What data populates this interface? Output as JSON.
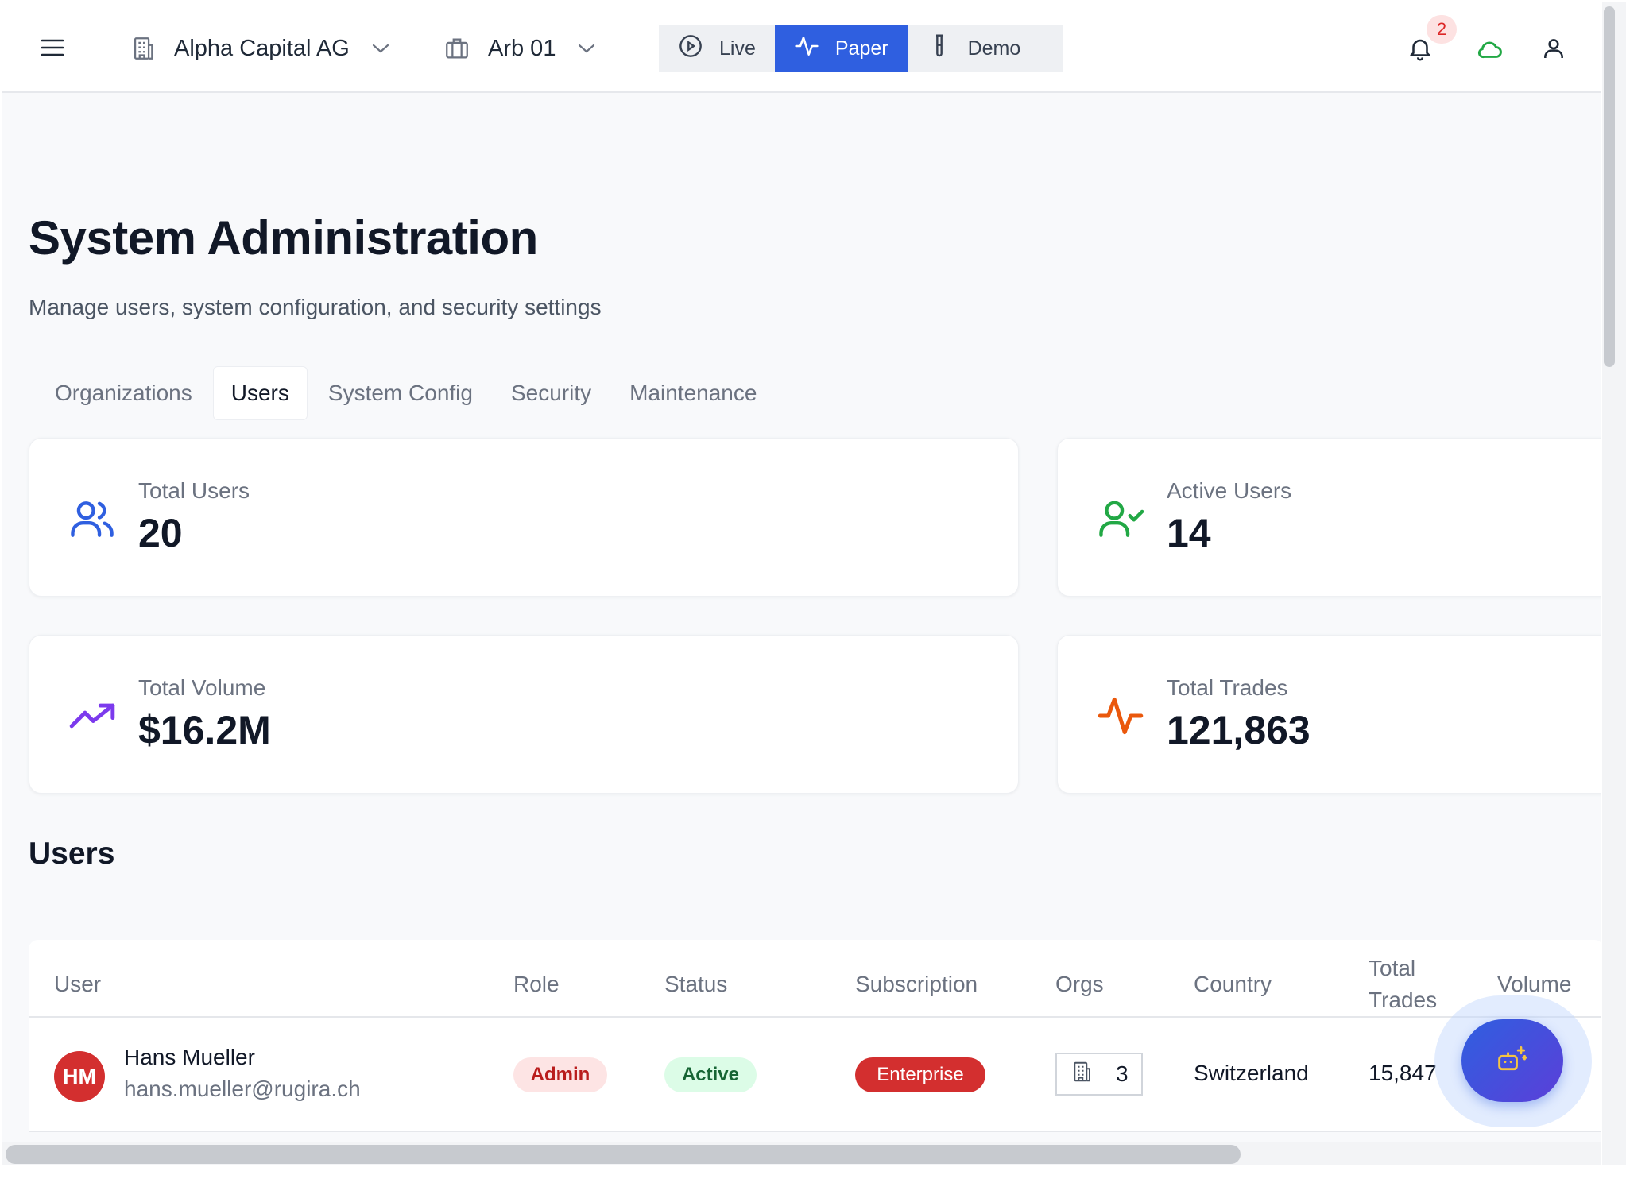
{
  "header": {
    "org_name": "Alpha Capital AG",
    "account_name": "Arb 01",
    "modes": [
      {
        "label": "Live",
        "icon": "play-circle-icon"
      },
      {
        "label": "Paper",
        "icon": "activity-icon"
      },
      {
        "label": "Demo",
        "icon": "test-tube-icon"
      }
    ],
    "active_mode": "Paper",
    "notification_count": "2",
    "connection_status_color": "#22a845",
    "accent_color": "#2f5fe0"
  },
  "page": {
    "title": "System Administration",
    "subtitle": "Manage users, system configuration, and security settings"
  },
  "tabs": [
    {
      "label": "Organizations"
    },
    {
      "label": "Users"
    },
    {
      "label": "System Config"
    },
    {
      "label": "Security"
    },
    {
      "label": "Maintenance"
    }
  ],
  "active_tab": "Users",
  "stats": [
    {
      "label": "Total Users",
      "value": "20",
      "icon": "users-icon",
      "color": "#2f5fe0"
    },
    {
      "label": "Active Users",
      "value": "14",
      "icon": "user-check-icon",
      "color": "#22a845"
    },
    {
      "label": "Total Volume",
      "value": "$16.2M",
      "icon": "trending-up-icon",
      "color": "#7c3aed"
    },
    {
      "label": "Total Trades",
      "value": "121,863",
      "icon": "activity-icon",
      "color": "#ea580c"
    }
  ],
  "users_section": {
    "title": "Users",
    "columns": [
      "User",
      "Role",
      "Status",
      "Subscription",
      "Orgs",
      "Country",
      "Total Trades",
      "Volume"
    ],
    "rows": [
      {
        "initials": "HM",
        "name": "Hans Mueller",
        "email": "hans.mueller@rugira.ch",
        "role": "Admin",
        "status": "Active",
        "subscription": "Enterprise",
        "orgs": "3",
        "country": "Switzerland",
        "total_trades": "15,847"
      }
    ]
  }
}
